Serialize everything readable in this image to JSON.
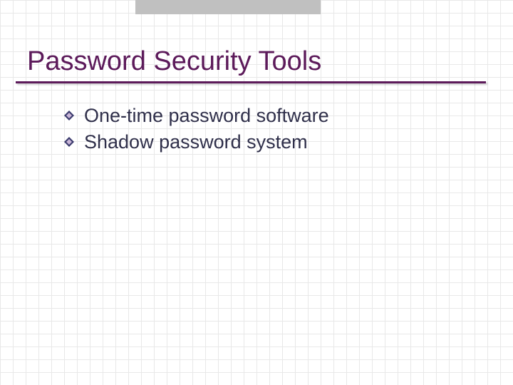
{
  "slide": {
    "title": "Password Security Tools",
    "bullets": [
      {
        "text": "One-time password software"
      },
      {
        "text": "Shadow password system"
      }
    ]
  },
  "colors": {
    "accent": "#5c1a5a",
    "bullet_outer": "#3b3b6d",
    "bullet_inner": "#c9b6d8"
  }
}
